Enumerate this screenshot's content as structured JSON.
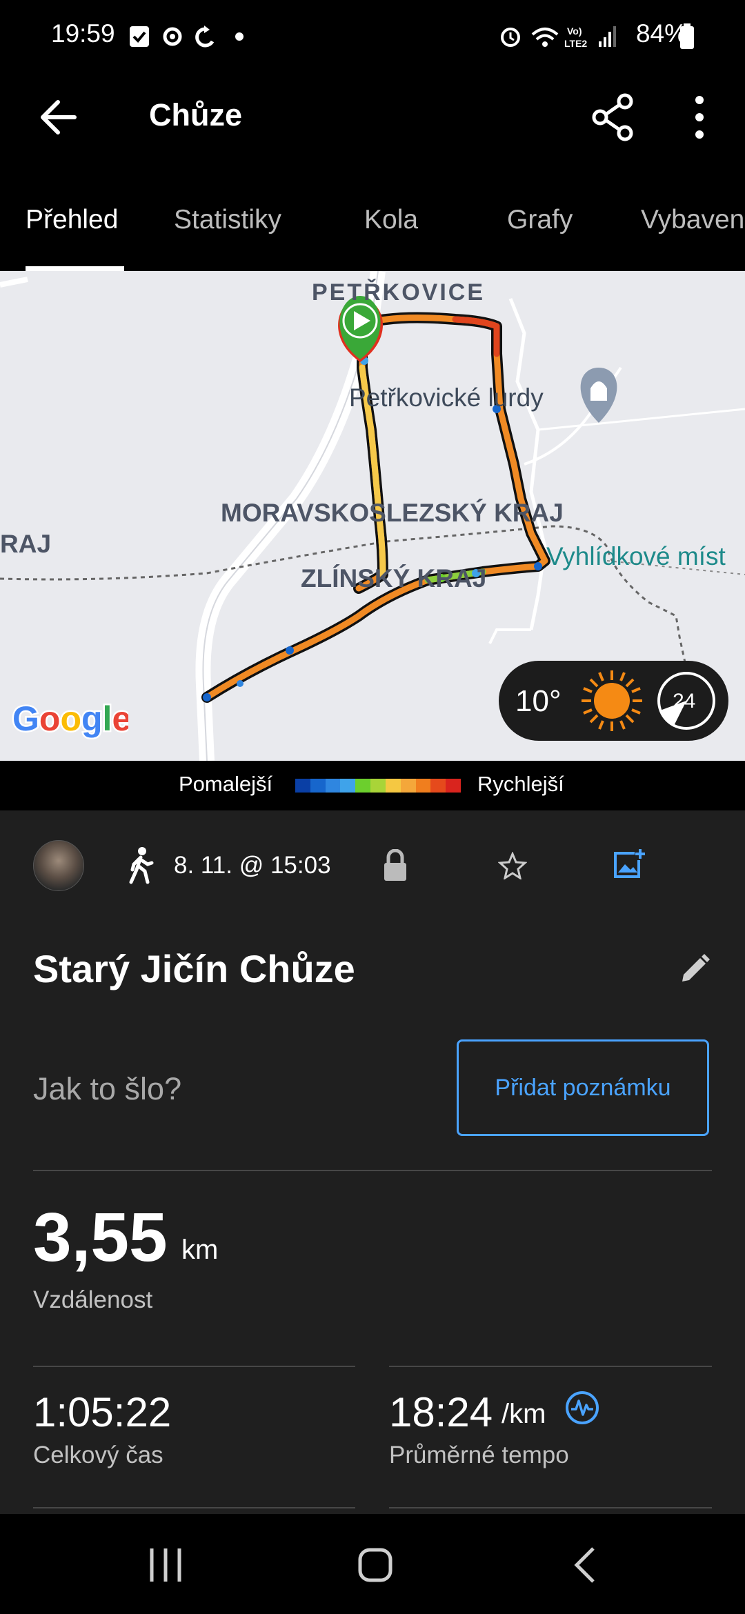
{
  "status_bar": {
    "time": "19:59",
    "battery": "84%",
    "network": "Vo) LTE2"
  },
  "app_bar": {
    "title": "Chůze"
  },
  "tabs": [
    {
      "label": "Přehled",
      "active": true
    },
    {
      "label": "Statistiky",
      "active": false
    },
    {
      "label": "Kola",
      "active": false
    },
    {
      "label": "Grafy",
      "active": false
    },
    {
      "label": "Vybaven",
      "active": false
    }
  ],
  "map": {
    "labels": {
      "petrkovice": "PETŘKOVICE",
      "lurdy": "Petřkovické lurdy",
      "moravskoslezsky": "MORAVSKOSLEZSKÝ KRAJ",
      "zlinsky": "ZLÍNSKÝ KRAJ",
      "kraj_left": "RAJ",
      "vyhlidkove": "Vyhlídkové míst"
    },
    "google": "Google",
    "weather": {
      "temperature": "10°",
      "wind": "24",
      "icon": "sun-icon"
    }
  },
  "legend": {
    "slower": "Pomalejší",
    "faster": "Rychlejší",
    "colors": [
      "#0a3fa5",
      "#1766cc",
      "#2f86e0",
      "#3fa3ea",
      "#6ccf2d",
      "#a9d438",
      "#f5c842",
      "#f4a73a",
      "#f07e1e",
      "#e54a1c",
      "#d9241e"
    ]
  },
  "activity": {
    "datetime": "8. 11. @ 15:03",
    "title": "Starý Jičín Chůze",
    "prompt": "Jak to šlo?",
    "add_note": "Přidat poznámku",
    "distance": {
      "value": "3,55",
      "unit": "km",
      "label": "Vzdálenost"
    },
    "total_time": {
      "value": "1:05:22",
      "label": "Celkový čas"
    },
    "avg_pace": {
      "value": "18:24",
      "unit": "/km",
      "label": "Průměrné tempo"
    }
  },
  "colors": {
    "accent": "#4aa3ff",
    "background": "#1f1f1f"
  }
}
